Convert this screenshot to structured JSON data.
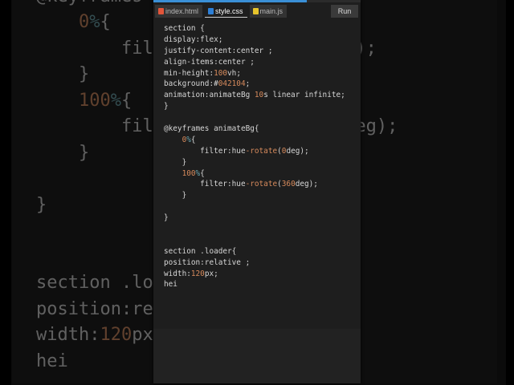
{
  "tabs": [
    {
      "label": "index.html",
      "icon": "html-file-icon",
      "active": false
    },
    {
      "label": "style.css",
      "icon": "css-file-icon",
      "active": true
    },
    {
      "label": "main.js",
      "icon": "js-file-icon",
      "active": false
    }
  ],
  "run_label": "Run",
  "progress_percent": 74,
  "colors": {
    "accent": "#3a8fd6",
    "number": "#d68a5c",
    "editor_bg": "#1e1e1e"
  },
  "code_lines": [
    [
      [
        "section {",
        ""
      ]
    ],
    [
      [
        "display:flex;",
        ""
      ]
    ],
    [
      [
        "justify-content:center ;",
        ""
      ]
    ],
    [
      [
        "align-items:center ;",
        ""
      ]
    ],
    [
      [
        "min-height:",
        ""
      ],
      [
        "100",
        "num"
      ],
      [
        "vh;",
        ""
      ]
    ],
    [
      [
        "background:#",
        ""
      ],
      [
        "042104",
        "num"
      ],
      [
        ";",
        ""
      ]
    ],
    [
      [
        "animation:animateBg ",
        ""
      ],
      [
        "10",
        "num"
      ],
      [
        "s linear infinite;",
        ""
      ]
    ],
    [
      [
        "}",
        ""
      ]
    ],
    [],
    [
      [
        "@keyframes animateBg{",
        ""
      ]
    ],
    [
      [
        "    ",
        ""
      ],
      [
        "0",
        "num"
      ],
      [
        "%",
        "pct"
      ],
      [
        "{",
        ""
      ]
    ],
    [
      [
        "        filter:hue",
        ""
      ],
      [
        "-rotate",
        "fn"
      ],
      [
        "(",
        ""
      ],
      [
        "0",
        "num"
      ],
      [
        "deg);",
        ""
      ]
    ],
    [
      [
        "    }",
        ""
      ]
    ],
    [
      [
        "    ",
        ""
      ],
      [
        "100",
        "num"
      ],
      [
        "%",
        "pct"
      ],
      [
        "{",
        ""
      ]
    ],
    [
      [
        "        filter:hue",
        ""
      ],
      [
        "-rotate",
        "fn"
      ],
      [
        "(",
        ""
      ],
      [
        "360",
        "num"
      ],
      [
        "deg);",
        ""
      ]
    ],
    [
      [
        "    }",
        ""
      ]
    ],
    [],
    [
      [
        "}",
        ""
      ]
    ],
    [],
    [],
    [
      [
        "section .loader{",
        ""
      ]
    ],
    [
      [
        "position:relative ;",
        ""
      ]
    ],
    [
      [
        "width:",
        ""
      ],
      [
        "120",
        "num"
      ],
      [
        "px;",
        ""
      ]
    ],
    [
      [
        "hei",
        ""
      ]
    ]
  ]
}
